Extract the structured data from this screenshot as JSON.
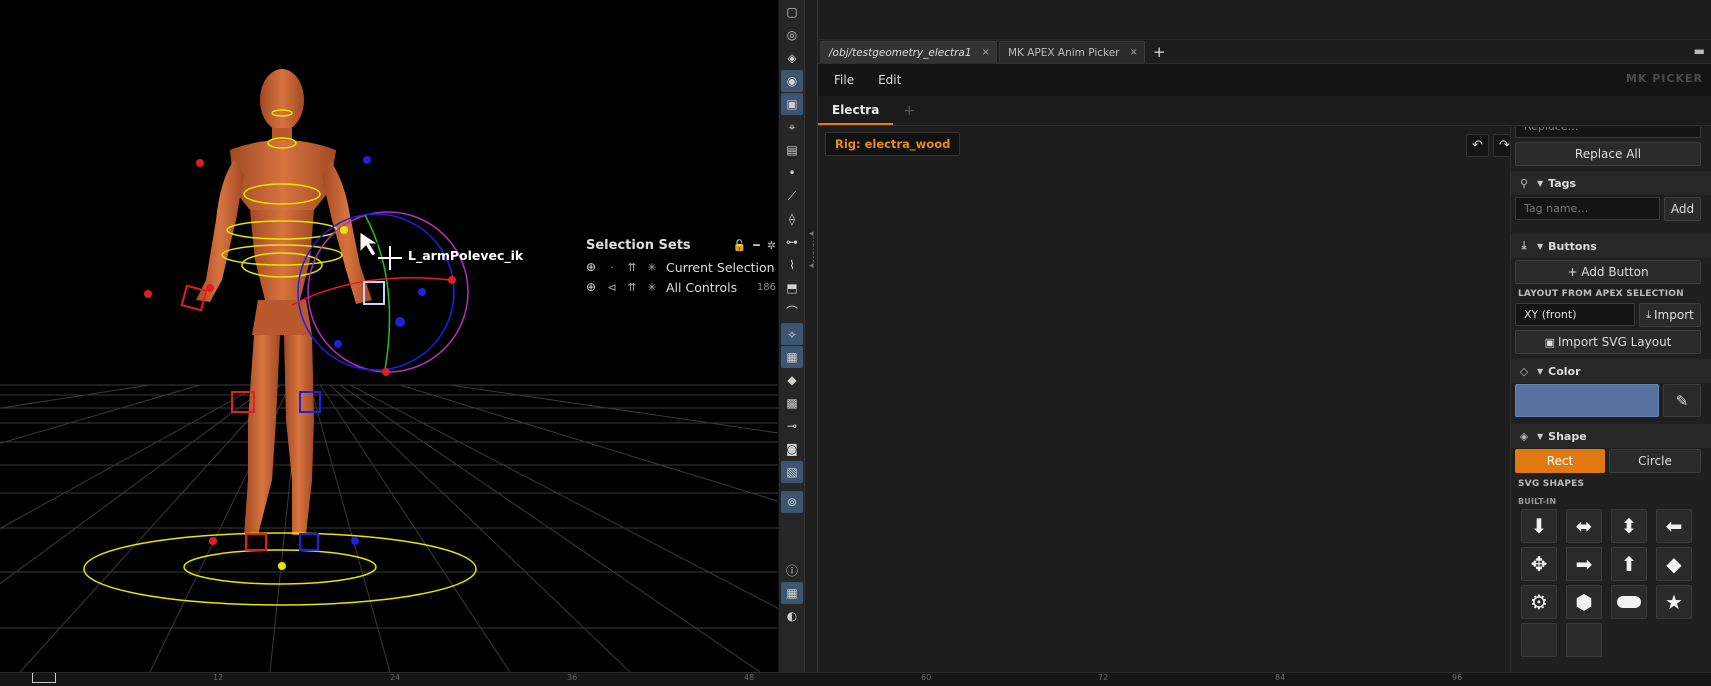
{
  "viewport": {
    "bone_label": "L_armPolevec_ik",
    "selection_sets": {
      "title": "Selection Sets",
      "rows": [
        {
          "label": "Current Selection",
          "count": ""
        },
        {
          "label": "All Controls",
          "count": "186"
        }
      ]
    }
  },
  "toolbar": {
    "icons": [
      "select-icon",
      "view-icon",
      "pose-icon",
      "handle-icon",
      "brush-icon",
      "camera-icon",
      "paint-icon",
      "point-icon",
      "edge-icon",
      "knife-icon",
      "grab-icon",
      "sculpt-icon",
      "cube-icon",
      "curve-icon",
      "bend-icon",
      "stamp-icon",
      "layer-icon",
      "surface-icon",
      "pin-icon",
      "frame-icon",
      "image-icon",
      "location-icon",
      "info-icon",
      "grid-icon",
      "eye-icon"
    ]
  },
  "panel": {
    "tabs": [
      {
        "label": "/obj/testgeometry_electra1",
        "active": true
      },
      {
        "label": "MK APEX Anim Picker",
        "active": false
      }
    ],
    "menu": [
      "File",
      "Edit"
    ],
    "brand": "MK PICKER",
    "doc_tab": "Electra",
    "rig_badge": "Rig: electra_wood",
    "sidebar": {
      "replace_placeholder": "Replace…",
      "replace_all": "Replace All",
      "tags": {
        "title": "Tags",
        "placeholder": "Tag name…",
        "add": "Add"
      },
      "buttons": {
        "title": "Buttons",
        "add_button": "+ Add Button",
        "layout_label": "LAYOUT FROM APEX SELECTION",
        "plane_value": "XY  (front)",
        "import": "Import",
        "import_svg": "Import SVG Layout"
      },
      "color": {
        "title": "Color",
        "swatch": "#5670a0"
      },
      "shape": {
        "title": "Shape",
        "rect": "Rect",
        "circle": "Circle",
        "svg_label": "SVG SHAPES",
        "builtin_label": "BUILT-IN"
      },
      "shapes": [
        "arrow-down-icon",
        "arrow-left-right-icon",
        "arrow-up-down-icon",
        "arrow-left-icon",
        "move-icon",
        "arrow-right-icon",
        "arrow-up-icon",
        "diamond-icon",
        "gear-icon",
        "hexagon-icon",
        "pill-icon",
        "star-icon"
      ]
    }
  },
  "timeline": {
    "ticks": [
      "12",
      "24",
      "36",
      "48",
      "60",
      "72",
      "84",
      "96"
    ]
  }
}
